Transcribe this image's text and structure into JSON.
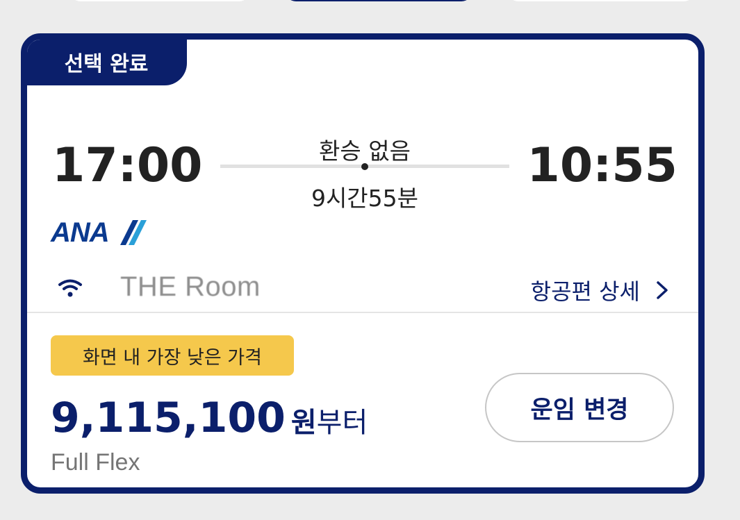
{
  "card": {
    "selected_label": "선택 완료",
    "departure_time": "17:00",
    "arrival_time": "10:55",
    "stops": "환승 없음",
    "duration": "9시간55분",
    "airline_logo_text": "ANA",
    "lounge_text": "THE Room",
    "details_link": "항공편 상세",
    "lowest_badge": "화면 내 가장 낮은 가격",
    "price_amount": "9,115,100",
    "price_currency": "원",
    "price_suffix": "부터",
    "fare_class": "Full Flex",
    "change_fare_button": "운임 변경"
  },
  "colors": {
    "navy": "#0b1f6b",
    "badge_yellow": "#f5c84c",
    "ana_blue": "#0b3a8f",
    "ana_light_blue": "#2aa0d8"
  },
  "icons": {
    "wifi": "wifi-icon",
    "chevron": "chevron-right-icon"
  }
}
